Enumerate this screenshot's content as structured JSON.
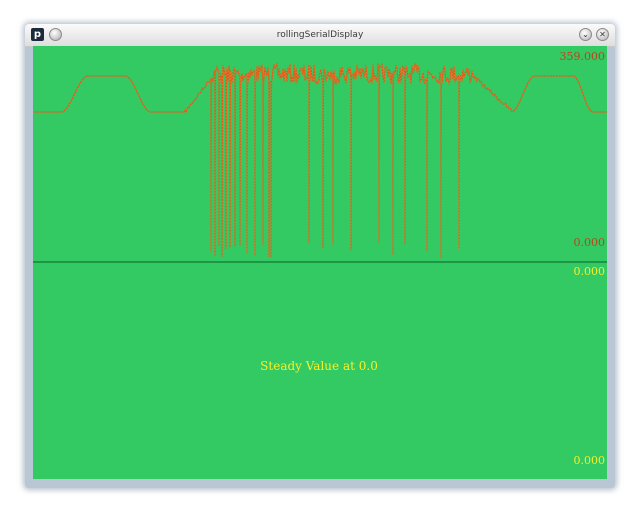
{
  "window": {
    "title": "rollingSerialDisplay",
    "app_icon_glyph": "p",
    "minimize_glyph": "⌄",
    "close_glyph": "✕"
  },
  "colors": {
    "background": "#33c963",
    "trace": "#e0591a",
    "trace_light": "#f08a2a",
    "label_top": "#b8461c",
    "label_bottom": "#f6f02a",
    "divider": "#1e9648"
  },
  "top_graph": {
    "max_label": "359.000",
    "min_label": "0.000"
  },
  "bottom_graph": {
    "max_label": "0.000",
    "min_label": "0.000",
    "message": "Steady Value at 0.0"
  }
}
